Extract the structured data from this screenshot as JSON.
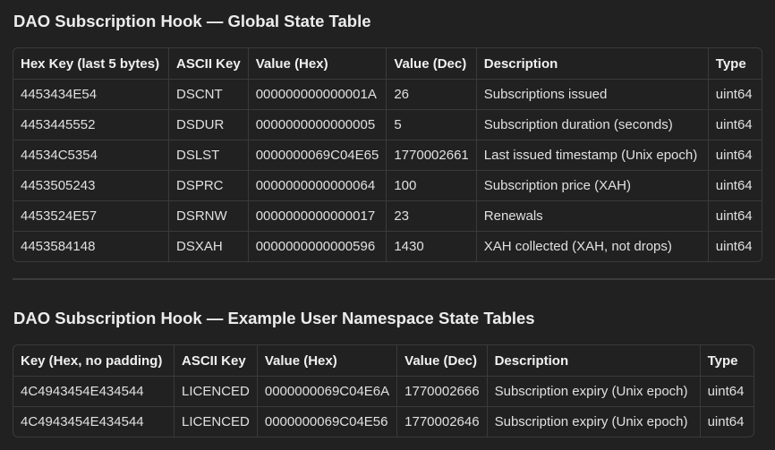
{
  "global": {
    "title": "DAO Subscription Hook — Global State Table",
    "headers": [
      "Hex Key (last 5 bytes)",
      "ASCII Key",
      "Value (Hex)",
      "Value (Dec)",
      "Description",
      "Type"
    ],
    "rows": [
      [
        "4453434E54",
        "DSCNT",
        "000000000000001A",
        "26",
        "Subscriptions issued",
        "uint64"
      ],
      [
        "4453445552",
        "DSDUR",
        "0000000000000005",
        "5",
        "Subscription duration (seconds)",
        "uint64"
      ],
      [
        "44534C5354",
        "DSLST",
        "0000000069C04E65",
        "1770002661",
        "Last issued timestamp (Unix epoch)",
        "uint64"
      ],
      [
        "4453505243",
        "DSPRC",
        "0000000000000064",
        "100",
        "Subscription price (XAH)",
        "uint64"
      ],
      [
        "4453524E57",
        "DSRNW",
        "0000000000000017",
        "23",
        "Renewals",
        "uint64"
      ],
      [
        "4453584148",
        "DSXAH",
        "0000000000000596",
        "1430",
        "XAH collected (XAH, not drops)",
        "uint64"
      ]
    ]
  },
  "user": {
    "title": "DAO Subscription Hook — Example User Namespace State Tables",
    "headers": [
      "Key (Hex, no padding)",
      "ASCII Key",
      "Value (Hex)",
      "Value (Dec)",
      "Description",
      "Type"
    ],
    "rows": [
      [
        "4C4943454E434544",
        "LICENCED",
        "0000000069C04E6A",
        "1770002666",
        "Subscription expiry (Unix epoch)",
        "uint64"
      ],
      [
        "4C4943454E434544",
        "LICENCED",
        "0000000069C04E56",
        "1770002646",
        "Subscription expiry (Unix epoch)",
        "uint64"
      ]
    ]
  }
}
